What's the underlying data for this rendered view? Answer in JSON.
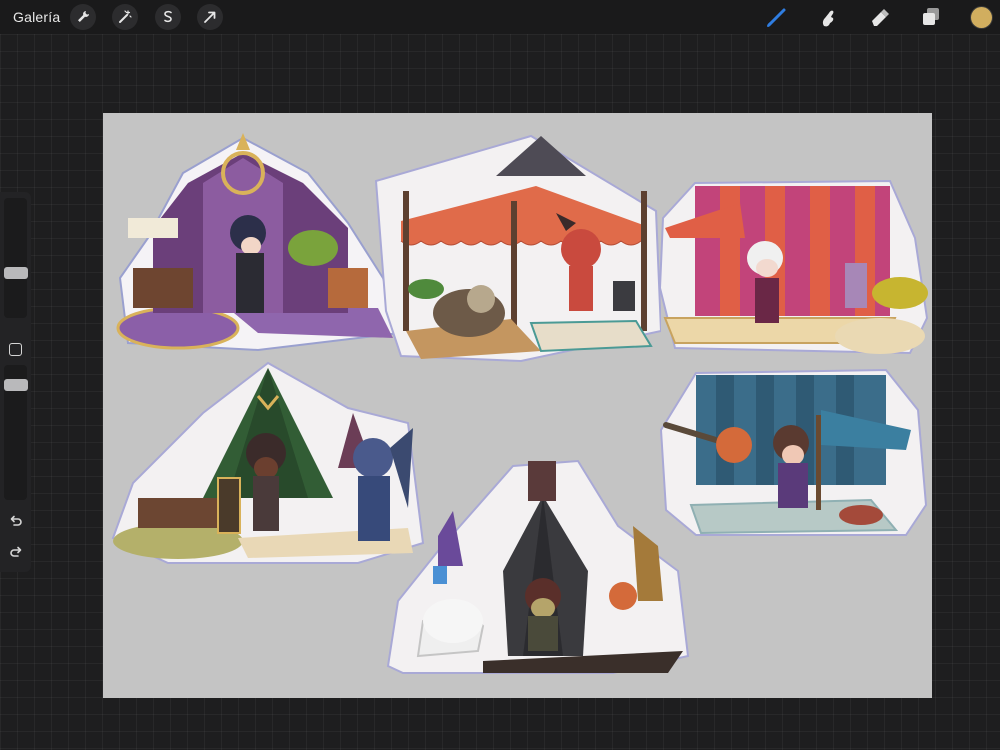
{
  "toolbar": {
    "gallery_label": "Galería",
    "left_tools": [
      {
        "name": "wrench-icon"
      },
      {
        "name": "magic-wand-icon"
      },
      {
        "name": "selection-icon"
      },
      {
        "name": "transform-arrow-icon"
      }
    ],
    "right_tools": [
      {
        "name": "brush-icon",
        "active": true
      },
      {
        "name": "smudge-icon"
      },
      {
        "name": "eraser-icon"
      },
      {
        "name": "layers-icon"
      }
    ],
    "active_color": "#d1ae5f"
  },
  "sidebar": {
    "brush_size_slider": "brush-size",
    "opacity_slider": "opacity",
    "undo_icon": "undo-icon",
    "redo_icon": "redo-icon"
  },
  "canvas": {
    "background": "#c4c4c4",
    "artwork": [
      {
        "name": "sticker-purple-tent-scholar"
      },
      {
        "name": "sticker-red-awning-tiefling-owlbear"
      },
      {
        "name": "sticker-striped-tent-vampire"
      },
      {
        "name": "sticker-green-tent-cleric-devil"
      },
      {
        "name": "sticker-blue-tent-wizard"
      },
      {
        "name": "sticker-dark-tent-githyanki-dog"
      }
    ]
  },
  "colors": {
    "accent": "#2f7de1",
    "toolbar_bg": "#1a1a1b",
    "workspace_bg": "#1e1e1f"
  }
}
